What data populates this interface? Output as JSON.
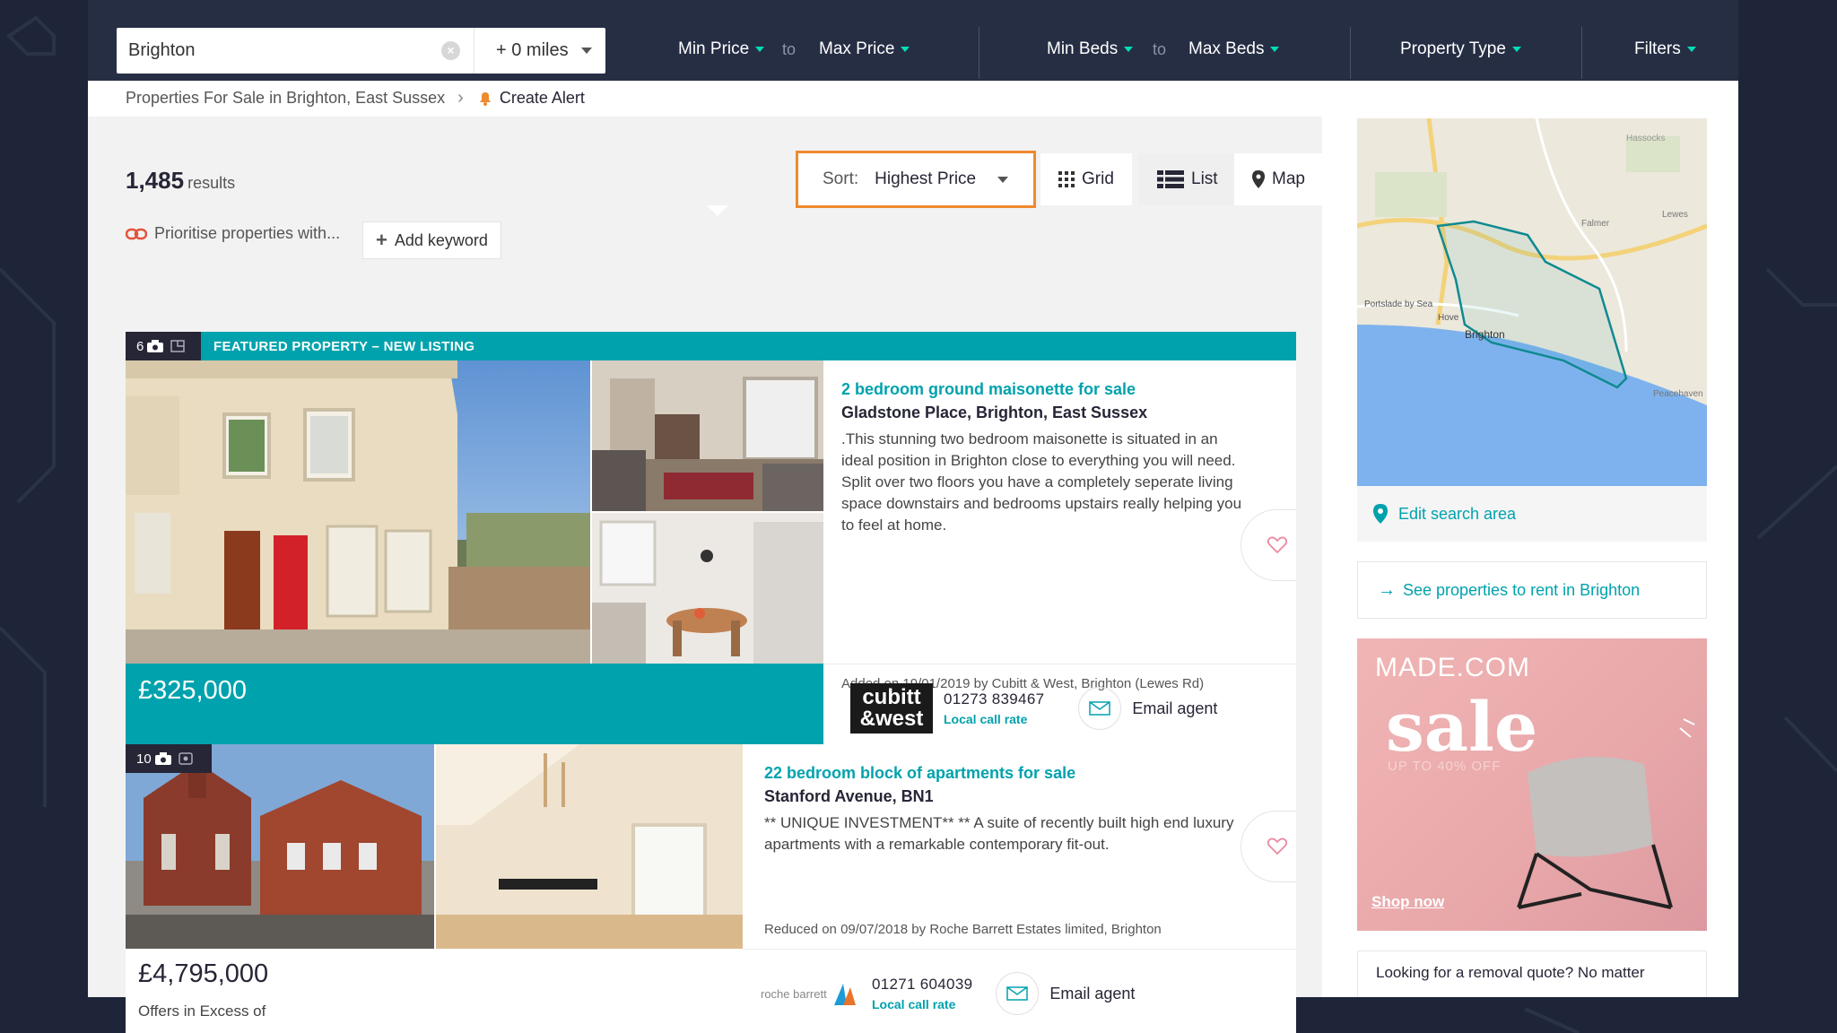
{
  "search": {
    "location": "Brighton",
    "radius": "+ 0 miles",
    "min_price": "Min Price",
    "to1": "to",
    "max_price": "Max Price",
    "min_beds": "Min Beds",
    "to2": "to",
    "max_beds": "Max Beds",
    "property_type": "Property Type",
    "filters": "Filters"
  },
  "breadcrumb": {
    "path": "Properties For Sale in Brighton, East Sussex",
    "alert": "Create Alert"
  },
  "results": {
    "count": "1,485",
    "label": "results"
  },
  "sort": {
    "label": "Sort:",
    "value": "Highest Price"
  },
  "views": {
    "grid": "Grid",
    "list": "List",
    "map": "Map"
  },
  "prioritise": {
    "text": "Prioritise properties with...",
    "add_keyword": "Add keyword"
  },
  "listings": [
    {
      "photo_count": "6",
      "banner": "FEATURED PROPERTY – NEW LISTING",
      "price": "£325,000",
      "title": "2 bedroom ground maisonette for sale",
      "address": "Gladstone Place, Brighton, East Sussex",
      "description": ".This stunning two bedroom maisonette is situated in an ideal position in Brighton close to everything you will need. Split over two floors you have a completely seperate living space downstairs and bedrooms upstairs really helping you to feel at home.",
      "added": "Added on 19/01/2019 by Cubitt & West, Brighton (Lewes Rd)",
      "agent_logo_line1": "cubitt",
      "agent_logo_line2": "&west",
      "phone": "01273 839467",
      "local": "Local call rate",
      "email": "Email agent"
    },
    {
      "photo_count": "10",
      "price": "£4,795,000",
      "price_qualifier": "Offers in Excess of",
      "title": "22 bedroom block of apartments for sale",
      "address": "Stanford Avenue, BN1",
      "description": "** UNIQUE INVESTMENT** ** A suite of recently built high end luxury apartments with a remarkable contemporary fit-out.",
      "added": "Reduced on 09/07/2018 by Roche Barrett Estates limited, Brighton",
      "agent_logo": "roche barrett",
      "phone": "01271 604039",
      "local": "Local call rate",
      "email": "Email agent"
    }
  ],
  "sidebar": {
    "edit_search": "Edit search area",
    "rent_link": "See properties to rent in Brighton",
    "map_labels": [
      "Brighton",
      "Hove",
      "Portslade by Sea",
      "Falmer",
      "Lewes",
      "Peacehaven",
      "Hassocks"
    ],
    "ad": {
      "brand": "MADE.COM",
      "headline": "sale",
      "subline": "UP TO 40% OFF",
      "cta": "Shop now"
    },
    "removal": "Looking for a removal quote? No matter"
  },
  "colors": {
    "teal": "#00a2ad",
    "orange": "#ef8a2f",
    "dark": "#262637",
    "accent_caret": "#00deb6"
  }
}
